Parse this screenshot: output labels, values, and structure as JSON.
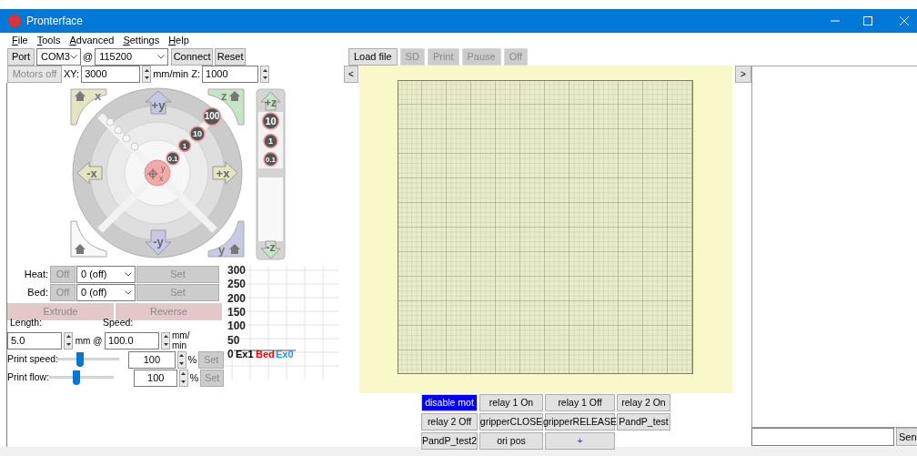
{
  "window": {
    "title": "Pronterface"
  },
  "menu": [
    "File",
    "Tools",
    "Advanced",
    "Settings",
    "Help"
  ],
  "connection": {
    "port_button": "Port",
    "port": "COM3",
    "at": "@",
    "baud": "115200",
    "connect": "Connect",
    "reset": "Reset"
  },
  "motion": {
    "motors_off": "Motors off",
    "xy_label": "XY:",
    "xy_feed": "3000",
    "z_label": "mm/min Z:",
    "z_feed": "1000"
  },
  "jog": {
    "home_labels": [
      "x",
      "z",
      "y"
    ],
    "xy_arrows": [
      "+y",
      "-y",
      "-x",
      "+x"
    ],
    "steps": [
      "100",
      "10",
      "1",
      "0.1"
    ],
    "center": [
      "y",
      "x"
    ],
    "z_arrows": [
      "+z",
      "-z"
    ],
    "z_steps": [
      "10",
      "1",
      "0.1"
    ]
  },
  "temperature": [
    {
      "label": "Heat:",
      "off": "Off",
      "value": "0 (off)",
      "set": "Set"
    },
    {
      "label": "Bed:",
      "off": "Off",
      "value": "0 (off)",
      "set": "Set"
    }
  ],
  "extrude": {
    "extrude": "Extrude",
    "reverse": "Reverse",
    "length_label": "Length:",
    "length": "5.0",
    "length_unit": "mm @",
    "speed_label": "Speed:",
    "speed": "100.0",
    "speed_unit": "mm/ min"
  },
  "overrides": [
    {
      "label": "Print speed:",
      "level": 0.38,
      "value": "100",
      "unit": "%",
      "set": "Set"
    },
    {
      "label": "Print flow:",
      "level": 0.42,
      "value": "100",
      "unit": "%",
      "set": "Set"
    }
  ],
  "temp_graph": {
    "y_labels": [
      "300",
      "250",
      "200",
      "150",
      "100",
      "50",
      "0"
    ],
    "legend": [
      {
        "label": "Ex1",
        "color": "#000000"
      },
      {
        "label": "Bed",
        "color": "#ff0000"
      },
      {
        "label": "Ex0",
        "color": "#1e90ff"
      }
    ]
  },
  "print_controls": [
    {
      "label": "Load file",
      "disabled": false
    },
    {
      "label": "SD",
      "disabled": true
    },
    {
      "label": "Print",
      "disabled": true
    },
    {
      "label": "Pause",
      "disabled": true
    },
    {
      "label": "Off",
      "disabled": true
    }
  ],
  "panel_toggles": [
    "<",
    ">"
  ],
  "custom_buttons": [
    {
      "label": "disable mot",
      "selected": true
    },
    {
      "label": "relay 1 On",
      "selected": false
    },
    {
      "label": "relay 1 Off",
      "selected": false
    },
    {
      "label": "relay 2 On",
      "selected": false
    },
    {
      "label": "relay 2 Off",
      "selected": false
    },
    {
      "label": "gripperCLOSE",
      "selected": false
    },
    {
      "label": "gripperRELEASE",
      "selected": false
    },
    {
      "label": "PandP_test",
      "selected": false
    },
    {
      "label": "PandP_test2",
      "selected": false
    },
    {
      "label": "ori pos",
      "selected": false
    },
    {
      "label": "+",
      "selected": false
    }
  ],
  "console": {
    "send": "Sen"
  }
}
